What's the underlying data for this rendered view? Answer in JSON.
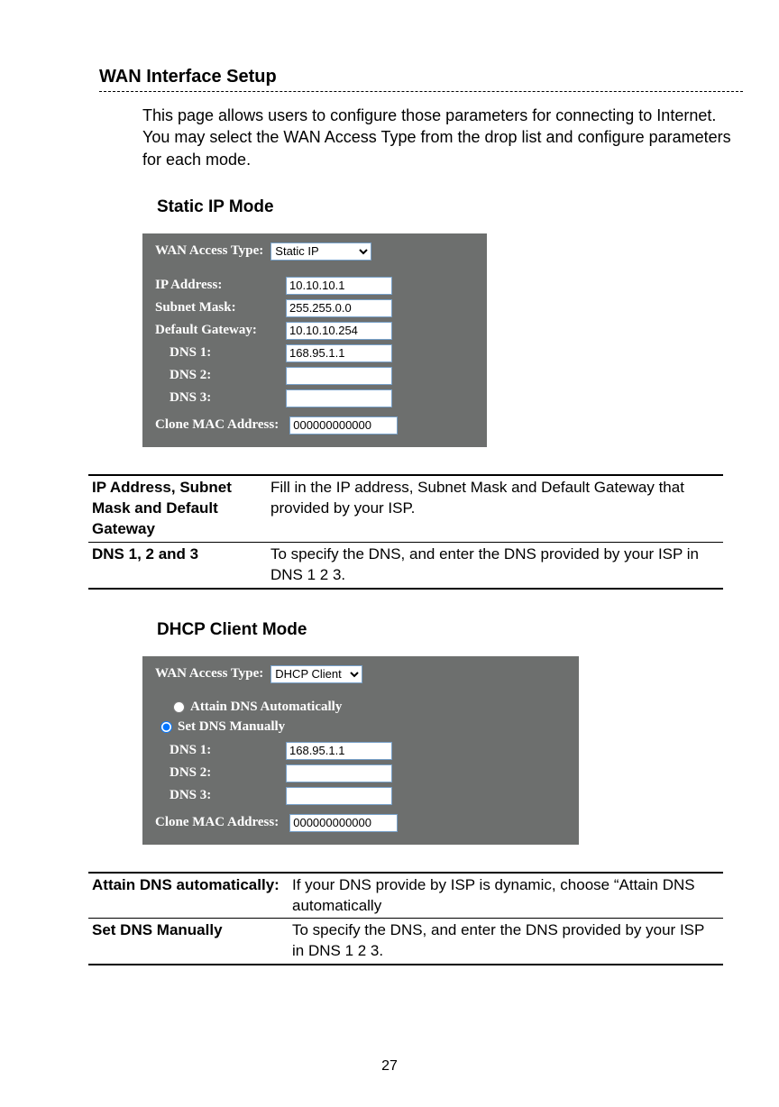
{
  "page": {
    "title": "WAN Interface Setup",
    "intro": "This page allows users to configure those parameters for connecting to Internet. You may select the WAN Access Type from the drop list and configure parameters for each mode.",
    "number": "27"
  },
  "static_mode": {
    "heading": "Static IP Mode",
    "panel": {
      "wan_access_type_label": "WAN Access Type:",
      "wan_access_type_value": "Static IP",
      "fields": {
        "ip_label": "IP Address:",
        "ip_value": "10.10.10.1",
        "subnet_label": "Subnet Mask:",
        "subnet_value": "255.255.0.0",
        "gw_label": "Default Gateway:",
        "gw_value": "10.10.10.254",
        "dns1_label": "DNS 1:",
        "dns1_value": "168.95.1.1",
        "dns2_label": "DNS 2:",
        "dns2_value": "",
        "dns3_label": "DNS 3:",
        "dns3_value": "",
        "clone_label": "Clone MAC Address:",
        "clone_value": "000000000000"
      }
    },
    "table": {
      "r1k": "IP Address, Subnet Mask and Default Gateway",
      "r1v": "Fill in the IP address, Subnet Mask and Default Gateway that provided by your ISP.",
      "r2k": "DNS 1, 2 and 3",
      "r2v": "To specify the DNS, and enter the DNS provided by your ISP in DNS 1 2 3."
    }
  },
  "dhcp_mode": {
    "heading": "DHCP Client Mode",
    "panel": {
      "wan_access_type_label": "WAN Access Type:",
      "wan_access_type_value": "DHCP Client",
      "radio": {
        "attain": "Attain DNS Automatically",
        "manual": "Set DNS Manually"
      },
      "fields": {
        "dns1_label": "DNS 1:",
        "dns1_value": "168.95.1.1",
        "dns2_label": "DNS 2:",
        "dns2_value": "",
        "dns3_label": "DNS 3:",
        "dns3_value": "",
        "clone_label": "Clone MAC Address:",
        "clone_value": "000000000000"
      }
    },
    "table": {
      "r1k": "Attain DNS automatically:",
      "r1v": "If your DNS provide by ISP is dynamic, choose “Attain DNS automatically",
      "r2k": "Set DNS Manually",
      "r2v": "To specify the DNS, and enter the DNS provided by your ISP in DNS 1 2 3."
    }
  }
}
